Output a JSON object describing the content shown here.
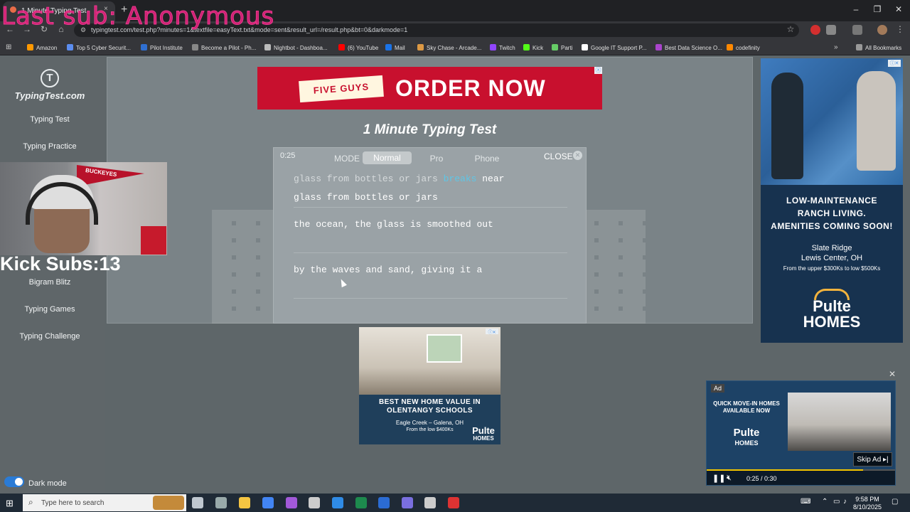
{
  "browser": {
    "tab_title": "1 Minute Typing Test",
    "tab_close": "×",
    "new_tab": "+",
    "url": "typingtest.com/test.php?minutes=1&textfile=easyText.txt&mode=sent&result_url=/result.php&bt=0&darkmode=1",
    "win_minimize": "–",
    "win_restore": "❐",
    "win_close": "✕",
    "bookmarks": [
      {
        "label": "Amazon",
        "color": "#f90"
      },
      {
        "label": "Top 5 Cyber Securit...",
        "color": "#5b8def"
      },
      {
        "label": "Pilot Institute",
        "color": "#2f6fd1"
      },
      {
        "label": "Become a Pilot - Ph...",
        "color": "#888"
      },
      {
        "label": "Nightbot - Dashboa...",
        "color": "#bbb"
      },
      {
        "label": "(6) YouTube",
        "color": "#f00"
      },
      {
        "label": "Mail",
        "color": "#1a73e8"
      },
      {
        "label": "Sky Chase - Arcade...",
        "color": "#d94"
      },
      {
        "label": "Twitch",
        "color": "#9146ff"
      },
      {
        "label": "Kick",
        "color": "#53fc18"
      },
      {
        "label": "Parti",
        "color": "#6c6"
      },
      {
        "label": "Google IT Support P...",
        "color": "#fff"
      },
      {
        "label": "Best Data Science O...",
        "color": "#a4c"
      },
      {
        "label": "codefinity",
        "color": "#f80"
      }
    ],
    "bookmarks_more": "»",
    "all_bookmarks": "All Bookmarks"
  },
  "stream_overlay": {
    "top_text": "Last sub: Anonymous",
    "kick_subs": "Kick Subs:13",
    "pennant_text": "BUCKEYES"
  },
  "sidebar": {
    "logo_mark": "T",
    "logo_text": "TypingTest.com",
    "items": [
      "Typing Test",
      "Typing Practice",
      "Bigram Blitz",
      "Typing Games",
      "Typing Challenge"
    ],
    "dark_mode_label": "Dark mode",
    "dark_mode_on": true
  },
  "top_ad": {
    "badge": "FIVE GUYS",
    "headline": "ORDER NOW"
  },
  "test": {
    "title": "1 Minute Typing Test",
    "timer": "0:25",
    "mode_label": "MODE",
    "modes": [
      "Normal",
      "Pro",
      "Phone"
    ],
    "active_mode": "Normal",
    "close_label": "CLOSE",
    "typed_done": "glass from bottles or jars ",
    "current_word": "breaks",
    "next_word": " near",
    "input_text": "glass from bottles or jars",
    "line2": "the ocean, the glass is smoothed out",
    "line3": "by the waves and sand, giving it a"
  },
  "right_ad": {
    "headline_1": "LOW-MAINTENANCE",
    "headline_2": "RANCH LIVING.",
    "headline_3": "AMENITIES COMING SOON!",
    "community": "Slate Ridge",
    "location": "Lewis Center, OH",
    "price": "From the upper $300Ks to low $500Ks",
    "brand_1": "Pulte",
    "brand_2": "HOMES"
  },
  "mid_ad": {
    "headline_1": "BEST NEW HOME VALUE IN",
    "headline_2": "OLENTANGY SCHOOLS",
    "location": "Eagle Creek – Galena, OH",
    "price": "From the low $400Ks",
    "brand_1": "Pulte",
    "brand_2": "HOMES"
  },
  "video_ad": {
    "ad_label": "Ad",
    "headline_1": "QUICK MOVE-IN HOMES",
    "headline_2": "AVAILABLE NOW",
    "brand_1": "Pulte",
    "brand_2": "HOMES",
    "skip_label": "Skip Ad ▸|",
    "time": "0:25 / 0:30",
    "progress": 0.83
  },
  "taskbar": {
    "search_placeholder": "Type here to search",
    "time": "9:58 PM",
    "date": "8/10/2025",
    "apps": [
      {
        "name": "task-view",
        "color": "#bfc7cf"
      },
      {
        "name": "app-1",
        "color": "#9aa"
      },
      {
        "name": "file-explorer",
        "color": "#f5c542"
      },
      {
        "name": "chrome",
        "color": "#4285f4"
      },
      {
        "name": "obs",
        "color": "#a259d9"
      },
      {
        "name": "settings",
        "color": "#ccc"
      },
      {
        "name": "app-blue",
        "color": "#2f8be6"
      },
      {
        "name": "excel",
        "color": "#1d8a4e"
      },
      {
        "name": "word",
        "color": "#2b6cd4"
      },
      {
        "name": "app-purple",
        "color": "#7a6fe0"
      },
      {
        "name": "app-tool",
        "color": "#ccc"
      },
      {
        "name": "app-red",
        "color": "#d33"
      }
    ]
  }
}
